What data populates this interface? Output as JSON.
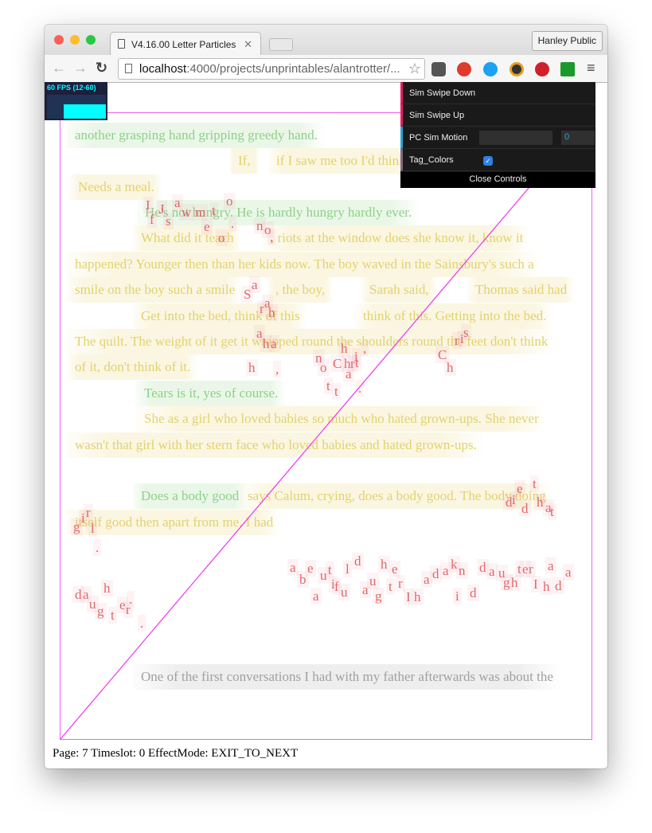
{
  "browser": {
    "tab_title": "V4.16.00 Letter Particles",
    "profile": "Hanley Public",
    "url_host": "localhost",
    "url_path": ":4000/projects/unprintables/alantrotter/..."
  },
  "fps": {
    "label": "60 FPS (12-60)"
  },
  "controls": {
    "sim_swipe_down": "Sim Swipe Down",
    "sim_swipe_up": "Sim Swipe Up",
    "pc_sim_motion": "PC Sim Motion",
    "pc_sim_motion_value": "0",
    "tag_colors": "Tag_Colors",
    "tag_colors_checked": true,
    "close": "Close Controls",
    "accent_colors": {
      "swipe": "#e61d5f",
      "motion": "#2fa1d6",
      "tag": "#806787"
    }
  },
  "text_colors": {
    "green": "#8fd08a",
    "yellow": "#e3d26e",
    "red": "#e06868",
    "grey": "#a0a0a0",
    "frame": "#f060f0"
  },
  "lines": [
    "another grasping hand gripping greedy hand.",
    "If,",
    "if I saw me too I'd think",
    "Needs a meal.",
    "He's not hungry. He is hardly hungry hardly ever.",
    "What did it teach",
    ", riots at the window does she know it, know it",
    "happened? Younger then than her kids now. The boy waved in the Sainsbury's such a",
    "smile on the boy such a smile",
    ", the boy,",
    "Sarah said,",
    "Thomas said had",
    "Get into the bed, think of this",
    "think of this. Getting into the bed.",
    "The quilt. The weight of it get it wrapped round the shoulders round the feet don't think",
    "of it, don't think of it.",
    "Tears is it, yes of course.",
    "She as a girl who loved babies so much who hated grown-ups. She never",
    "wasn't that girl with her stern face who loved babies and hated grown-ups.",
    "Does a body good",
    "says Calum, crying, does a body good. The body doing",
    "itself good then apart from me. I had",
    "One of the first conversations I had with my father afterwards was about the"
  ],
  "particles": [
    "I",
    "J",
    "a",
    "f",
    "s",
    "w",
    "m",
    "t",
    "o",
    "e",
    "o",
    ".",
    "n",
    "o",
    ",",
    "S",
    "a",
    "r",
    "a",
    "h",
    "a",
    "h",
    "a",
    "h",
    ",",
    "n",
    "o",
    "C",
    "h",
    "h",
    "r",
    "i",
    "t",
    ",",
    "a",
    "t",
    "t",
    ".",
    "C",
    "h",
    "r",
    "i",
    "s",
    "e",
    "t",
    "d",
    "i",
    "d",
    "h",
    "a",
    "t",
    "g",
    "i",
    "r",
    "l",
    ".",
    "d",
    "a",
    "h",
    "u",
    "g",
    "t",
    "e",
    "r",
    ".",
    ".",
    "a",
    "b",
    "e",
    "u",
    "t",
    "i",
    "f",
    "l",
    "d",
    "u",
    "a",
    "a",
    "u",
    "g",
    "t",
    "r",
    "h",
    "e",
    "I",
    "h",
    "a",
    "d",
    "a",
    "k",
    "n",
    "i",
    "d",
    "d",
    "a",
    "u",
    "g",
    "h",
    "t",
    "e",
    "r",
    "a",
    "a",
    "I",
    "h",
    "d"
  ],
  "status": "Page: 7 Timeslot: 0 EffectMode: EXIT_TO_NEXT"
}
